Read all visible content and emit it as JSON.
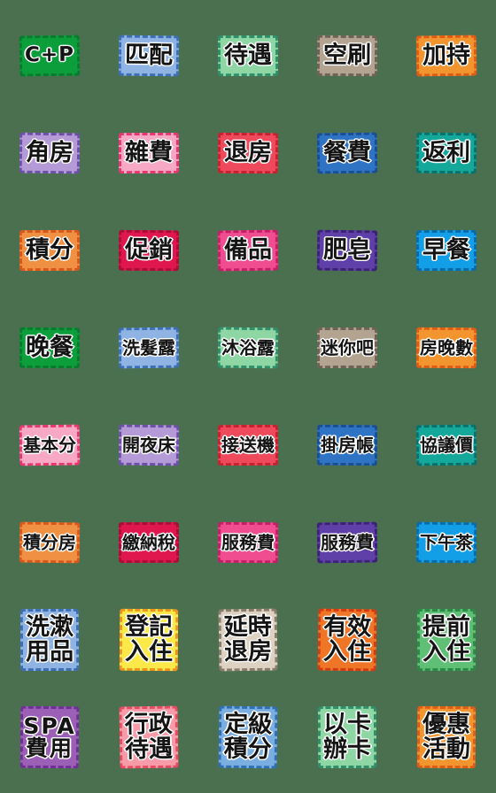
{
  "page": {
    "title": "Emoji sticker sheet",
    "background_color": "#4a7050",
    "columns": 5,
    "rows": 8,
    "sticker_count": 40
  },
  "stickers": [
    {
      "id": "c-plus-p",
      "lines": [
        "C+P"
      ],
      "latin": true,
      "bg": "#0d9e3c",
      "border": "#0b7a2e",
      "row": 1,
      "col": 1
    },
    {
      "id": "pi-pei",
      "lines": [
        "匹配"
      ],
      "latin": false,
      "bg": "#8fb4e3",
      "border": "#3c6fb5",
      "row": 1,
      "col": 2
    },
    {
      "id": "dai-yu",
      "lines": [
        "待遇"
      ],
      "latin": false,
      "bg": "#8ed6a4",
      "border": "#2e8f6a",
      "row": 1,
      "col": 3
    },
    {
      "id": "kong-shua",
      "lines": [
        "空刷"
      ],
      "latin": false,
      "bg": "#b3a491",
      "border": "#6f6256",
      "row": 1,
      "col": 4
    },
    {
      "id": "jia-chi",
      "lines": [
        "加持"
      ],
      "latin": false,
      "bg": "#f2952f",
      "border": "#e05a18",
      "row": 1,
      "col": 5
    },
    {
      "id": "jiao-fang",
      "lines": [
        "角房"
      ],
      "latin": false,
      "bg": "#b49ad6",
      "border": "#6b4fa8",
      "row": 2,
      "col": 1
    },
    {
      "id": "za-fei",
      "lines": [
        "雜費"
      ],
      "latin": false,
      "bg": "#f7a8c4",
      "border": "#e8366f",
      "row": 2,
      "col": 2
    },
    {
      "id": "tui-fang",
      "lines": [
        "退房"
      ],
      "latin": false,
      "bg": "#ef4a5c",
      "border": "#c6212f",
      "row": 2,
      "col": 3
    },
    {
      "id": "can-fei",
      "lines": [
        "餐費"
      ],
      "latin": false,
      "bg": "#2f74c4",
      "border": "#1b4e8f",
      "row": 2,
      "col": 4
    },
    {
      "id": "fan-li",
      "lines": [
        "返利"
      ],
      "latin": false,
      "bg": "#13a89a",
      "border": "#0a6f6a",
      "row": 2,
      "col": 5
    },
    {
      "id": "ji-fen",
      "lines": [
        "積分"
      ],
      "latin": false,
      "bg": "#ef9042",
      "border": "#d9571c",
      "row": 3,
      "col": 1
    },
    {
      "id": "cu-xiao",
      "lines": [
        "促銷"
      ],
      "latin": false,
      "bg": "#e0174f",
      "border": "#a80f36",
      "row": 3,
      "col": 2
    },
    {
      "id": "bei-pin",
      "lines": [
        "備品"
      ],
      "latin": false,
      "bg": "#ef4d90",
      "border": "#c41e66",
      "row": 3,
      "col": 3
    },
    {
      "id": "fei-zao",
      "lines": [
        "肥皂"
      ],
      "latin": false,
      "bg": "#5f3fa8",
      "border": "#3a2370",
      "row": 3,
      "col": 4
    },
    {
      "id": "zao-can",
      "lines": [
        "早餐"
      ],
      "latin": false,
      "bg": "#139fe8",
      "border": "#0a6aa8",
      "row": 3,
      "col": 5
    },
    {
      "id": "wan-can",
      "lines": [
        "晚餐"
      ],
      "latin": false,
      "bg": "#0d9e3c",
      "border": "#0b7a2e",
      "row": 4,
      "col": 1
    },
    {
      "id": "xi-fa-lu",
      "lines": [
        "洗髮露"
      ],
      "latin": false,
      "bg": "#8fb4e3",
      "border": "#3c6fb5",
      "row": 4,
      "col": 2
    },
    {
      "id": "mu-yu-lu",
      "lines": [
        "沐浴露"
      ],
      "latin": false,
      "bg": "#8ed6a4",
      "border": "#2e8f6a",
      "row": 4,
      "col": 3
    },
    {
      "id": "mi-ni-ba",
      "lines": [
        "迷你吧"
      ],
      "latin": false,
      "bg": "#b3a491",
      "border": "#6f6256",
      "row": 4,
      "col": 4
    },
    {
      "id": "fang-wan-shu",
      "lines": [
        "房晚數"
      ],
      "latin": false,
      "bg": "#f2952f",
      "border": "#e05a18",
      "row": 4,
      "col": 5
    },
    {
      "id": "ji-ben-fen",
      "lines": [
        "基本分"
      ],
      "latin": false,
      "bg": "#f7a8c4",
      "border": "#e8366f",
      "row": 5,
      "col": 1
    },
    {
      "id": "kai-ye-chuang",
      "lines": [
        "開夜床"
      ],
      "latin": false,
      "bg": "#b49ad6",
      "border": "#6b4fa8",
      "row": 5,
      "col": 2
    },
    {
      "id": "jie-song-ji",
      "lines": [
        "接送機"
      ],
      "latin": false,
      "bg": "#ef4a5c",
      "border": "#c6212f",
      "row": 5,
      "col": 3
    },
    {
      "id": "gua-fang-zhang",
      "lines": [
        "掛房帳"
      ],
      "latin": false,
      "bg": "#2f74c4",
      "border": "#1b4e8f",
      "row": 5,
      "col": 4
    },
    {
      "id": "xie-yi-jia",
      "lines": [
        "協議價"
      ],
      "latin": false,
      "bg": "#13a89a",
      "border": "#0a6f6a",
      "row": 5,
      "col": 5
    },
    {
      "id": "ji-fen-fang",
      "lines": [
        "積分房"
      ],
      "latin": false,
      "bg": "#ef9042",
      "border": "#d9571c",
      "row": 6,
      "col": 1
    },
    {
      "id": "jiao-na-shui",
      "lines": [
        "繳納稅"
      ],
      "latin": false,
      "bg": "#e0174f",
      "border": "#a80f36",
      "row": 6,
      "col": 2
    },
    {
      "id": "fu-wu-fei-pink",
      "lines": [
        "服務費"
      ],
      "latin": false,
      "bg": "#ef4d90",
      "border": "#c41e66",
      "row": 6,
      "col": 3
    },
    {
      "id": "fu-wu-fei-purple",
      "lines": [
        "服務費"
      ],
      "latin": false,
      "bg": "#5f3fa8",
      "border": "#3a2370",
      "row": 6,
      "col": 4
    },
    {
      "id": "xia-wu-cha",
      "lines": [
        "下午茶"
      ],
      "latin": false,
      "bg": "#139fe8",
      "border": "#0a6aa8",
      "row": 6,
      "col": 5
    },
    {
      "id": "xi-shu-yong-pin",
      "lines": [
        "洗漱",
        "用品"
      ],
      "latin": false,
      "bg": "#8fb4e3",
      "border": "#3c6fb5",
      "row": 7,
      "col": 1
    },
    {
      "id": "deng-ji-ru-zhu",
      "lines": [
        "登記",
        "入住"
      ],
      "latin": false,
      "bg": "#fbe94a",
      "border": "#f0921c",
      "row": 7,
      "col": 2
    },
    {
      "id": "yan-shi-tui-fang",
      "lines": [
        "延時",
        "退房"
      ],
      "latin": false,
      "bg": "#ddd2c2",
      "border": "#8a7b6a",
      "row": 7,
      "col": 3
    },
    {
      "id": "you-xiao-ru-zhu",
      "lines": [
        "有效",
        "入住"
      ],
      "latin": false,
      "bg": "#ef7527",
      "border": "#d43a14",
      "row": 7,
      "col": 4
    },
    {
      "id": "ti-qian-ru-zhu",
      "lines": [
        "提前",
        "入住"
      ],
      "latin": false,
      "bg": "#5fbf74",
      "border": "#2c8a47",
      "row": 7,
      "col": 5
    },
    {
      "id": "spa-fei-yong",
      "lines": [
        "SPA",
        "費用"
      ],
      "latin": true,
      "bg": "#9b5fb5",
      "border": "#6e2f96",
      "row": 8,
      "col": 1
    },
    {
      "id": "xing-zheng-dai-yu",
      "lines": [
        "行政",
        "待遇"
      ],
      "latin": false,
      "bg": "#f79ba8",
      "border": "#e84a62",
      "row": 8,
      "col": 2
    },
    {
      "id": "ding-ji-ji-fen",
      "lines": [
        "定級",
        "積分"
      ],
      "latin": false,
      "bg": "#7aaee0",
      "border": "#2f6fb5",
      "row": 8,
      "col": 3
    },
    {
      "id": "yi-ka-ban-ka",
      "lines": [
        "以卡",
        "辦卡"
      ],
      "latin": false,
      "bg": "#8ed6a4",
      "border": "#2e8f6a",
      "row": 8,
      "col": 4
    },
    {
      "id": "you-hui-huo-dong",
      "lines": [
        "優惠",
        "活動"
      ],
      "latin": false,
      "bg": "#f2952f",
      "border": "#e05a18",
      "row": 8,
      "col": 5
    }
  ]
}
